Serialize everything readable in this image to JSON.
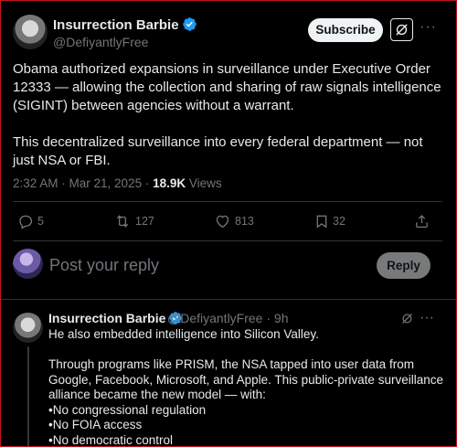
{
  "tweet": {
    "author_name": "Insurrection Barbie",
    "handle": "@DefiyantlyFree",
    "subscribe_label": "Subscribe",
    "text": "Obama authorized expansions in surveillance under Executive Order 12333 — allowing the collection and sharing of raw signals intelligence (SIGINT) between agencies without a warrant.\n\nThis decentralized surveillance into every federal department — not just NSA or FBI.",
    "timestamp": "2:32 AM · Mar 21, 2025 · ",
    "views_count": "18.9K",
    "views_label": " Views",
    "actions": {
      "replies": "5",
      "reposts": "127",
      "likes": "813",
      "bookmarks": "32"
    }
  },
  "composer": {
    "placeholder": "Post your reply",
    "reply_label": "Reply"
  },
  "reply": {
    "author_name": "Insurrection Barbie",
    "handle_time": "@DefiyantlyFree · 9h",
    "text": "He also embedded intelligence into Silicon Valley.\n\nThrough programs like PRISM, the NSA tapped into user data from Google, Facebook, Microsoft, and Apple. This public-private surveillance alliance became the new model — with:\n•No congressional regulation\n•No FOIA access\n•No democratic control"
  },
  "icons": [
    "verified-badge-icon",
    "grok-icon",
    "more-icon",
    "reply-icon",
    "repost-icon",
    "like-icon",
    "bookmark-icon",
    "share-icon"
  ],
  "colors": {
    "background": "#000000",
    "text_primary": "#e7e9ea",
    "text_secondary": "#71767b",
    "verified": "#1d9bf0",
    "border": "#2f3336",
    "frame": "#c4161c"
  }
}
